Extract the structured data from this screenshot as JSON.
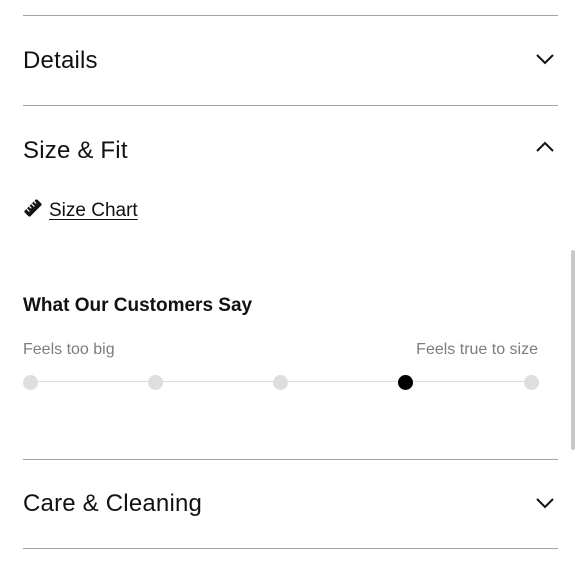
{
  "accordion": {
    "details": {
      "title": "Details",
      "icon": "chevron-down-icon",
      "expanded": false
    },
    "size_fit": {
      "title": "Size & Fit",
      "icon": "chevron-up-icon",
      "expanded": true
    },
    "care": {
      "title": "Care & Cleaning",
      "icon": "chevron-down-icon",
      "expanded": false
    }
  },
  "size_chart": {
    "label": "Size Chart",
    "icon": "ruler-icon"
  },
  "customers": {
    "heading": "What Our Customers Say",
    "left_label": "Feels too big",
    "right_label": "Feels true to size",
    "scale_points": 5,
    "selected_index": 3
  },
  "colors": {
    "divider": "#a8a39a",
    "muted_text": "#7d7d7d",
    "dot_inactive": "#dedede",
    "dot_active": "#000000"
  }
}
